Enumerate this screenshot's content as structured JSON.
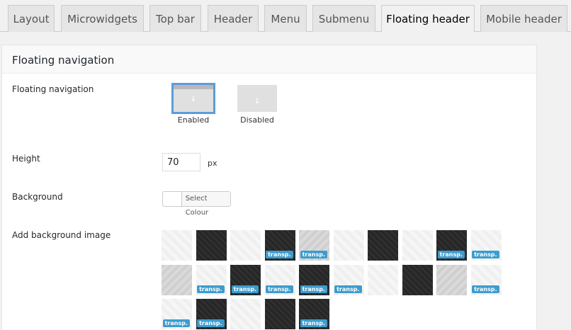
{
  "tabs": [
    "Layout",
    "Microwidgets",
    "Top bar",
    "Header",
    "Menu",
    "Submenu",
    "Floating header",
    "Mobile header"
  ],
  "active_tab": "Floating header",
  "panel": {
    "title": "Floating navigation",
    "floating_nav": {
      "label": "Floating navigation",
      "options": [
        "Enabled",
        "Disabled"
      ],
      "selected": "Enabled"
    },
    "height": {
      "label": "Height",
      "value": "70",
      "unit": "px"
    },
    "background": {
      "label": "Background",
      "button": "Select Colour"
    },
    "bg_image": {
      "label": "Add background image",
      "badge": "transp.",
      "patterns": [
        {
          "name": "pattern-1",
          "shade": "light",
          "transp": false
        },
        {
          "name": "pattern-2",
          "shade": "dark",
          "transp": false
        },
        {
          "name": "pattern-3",
          "shade": "light",
          "transp": false
        },
        {
          "name": "pattern-4",
          "shade": "dark",
          "transp": true
        },
        {
          "name": "pattern-5",
          "shade": "mid",
          "transp": true
        },
        {
          "name": "pattern-6",
          "shade": "light",
          "transp": false
        },
        {
          "name": "pattern-7",
          "shade": "dark",
          "transp": false
        },
        {
          "name": "pattern-8",
          "shade": "light",
          "transp": false
        },
        {
          "name": "pattern-9",
          "shade": "dark",
          "transp": true
        },
        {
          "name": "pattern-10",
          "shade": "light",
          "transp": true
        },
        {
          "name": "pattern-11",
          "shade": "mid",
          "transp": false
        },
        {
          "name": "pattern-12",
          "shade": "light",
          "transp": true
        },
        {
          "name": "pattern-13",
          "shade": "dark",
          "transp": true
        },
        {
          "name": "pattern-14",
          "shade": "light",
          "transp": true
        },
        {
          "name": "pattern-15",
          "shade": "dark",
          "transp": true
        },
        {
          "name": "pattern-16",
          "shade": "light",
          "transp": true
        },
        {
          "name": "pattern-17",
          "shade": "light",
          "transp": false
        },
        {
          "name": "pattern-18",
          "shade": "dark",
          "transp": false
        },
        {
          "name": "pattern-19",
          "shade": "mid",
          "transp": false
        },
        {
          "name": "pattern-20",
          "shade": "light",
          "transp": true
        },
        {
          "name": "pattern-21",
          "shade": "light",
          "transp": true
        },
        {
          "name": "pattern-22",
          "shade": "dark",
          "transp": true
        },
        {
          "name": "pattern-23",
          "shade": "light",
          "transp": false
        },
        {
          "name": "pattern-24",
          "shade": "dark",
          "transp": false
        },
        {
          "name": "pattern-25",
          "shade": "dark",
          "transp": true
        }
      ]
    }
  },
  "colors": {
    "accent": "#5b9dd9",
    "badge": "#3c9ccf"
  }
}
